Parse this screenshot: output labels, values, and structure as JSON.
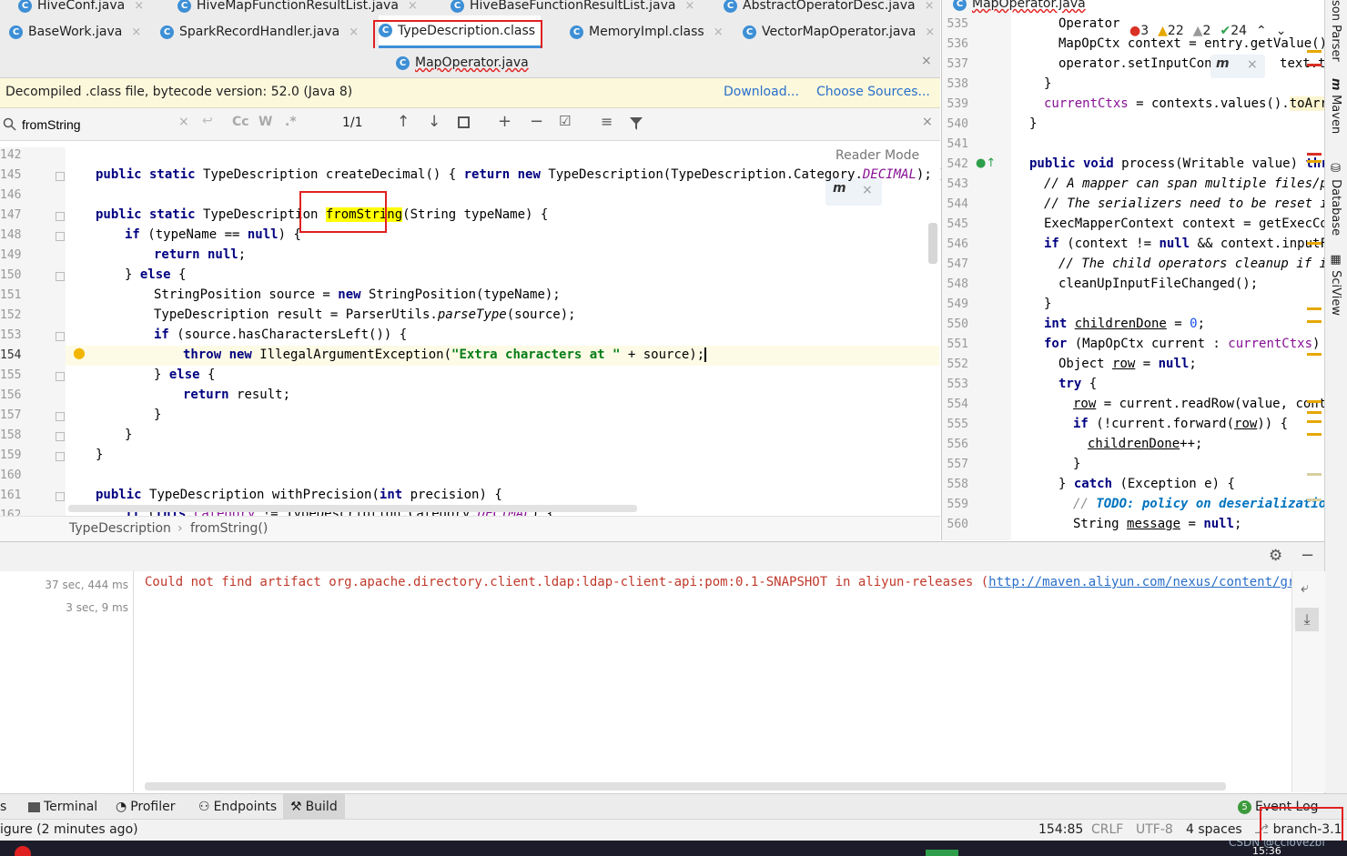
{
  "top_tabs_partial": [
    "HiveConf.java",
    "HiveMapFunctionResultList.java",
    "HiveBaseFunctionResultList.java",
    "AbstractOperatorDesc.java",
    "MapOperator.java"
  ],
  "tabs_row1": [
    "BaseWork.java",
    "SparkRecordHandler.java",
    "TypeDescription.class",
    "MemoryImpl.class",
    "VectorMapOperator.java"
  ],
  "tabs_row2": [
    "MapOperator.java"
  ],
  "banner": {
    "text": "Decompiled .class file, bytecode version: 52.0 (Java 8)",
    "download": "Download...",
    "choose_sources": "Choose Sources..."
  },
  "search": {
    "value": "fromString",
    "count": "1/1"
  },
  "reader_mode": "Reader Mode",
  "left_lines": [
    "142",
    "145",
    "146",
    "147",
    "148",
    "149",
    "150",
    "151",
    "152",
    "153",
    "154",
    "155",
    "156",
    "157",
    "158",
    "159",
    "160",
    "161",
    "162"
  ],
  "code": {
    "l145_a": "public static ",
    "l145_b": "TypeDescription createDecimal() { ",
    "l145_c": "return new ",
    "l145_d": "TypeDescription(TypeDescription.Category.",
    "l145_e": "DECIMAL",
    "l145_f": "); }",
    "l147_a": "public static ",
    "l147_b": "TypeDescription ",
    "l147_hl": "fromString",
    "l147_c": "(String typeName) {",
    "l148_a": "if ",
    "l148_b": "(typeName == ",
    "l148_c": "null",
    "l148_d": ") {",
    "l149_a": "return null",
    "l149_b": ";",
    "l150_a": "} ",
    "l150_b": "else ",
    "l150_c": "{",
    "l151_a": "StringPosition source = ",
    "l151_b": "new ",
    "l151_c": "StringPosition(typeName);",
    "l152_a": "TypeDescription result = ParserUtils.",
    "l152_b": "parseType",
    "l152_c": "(source);",
    "l153_a": "if ",
    "l153_b": "(source.hasCharactersLeft()) {",
    "l154_a": "throw new ",
    "l154_b": "IllegalArgumentException(",
    "l154_c": "\"Extra characters at \"",
    "l154_d": " + source);",
    "l155_a": "} ",
    "l155_b": "else ",
    "l155_c": "{",
    "l156_a": "return ",
    "l156_b": "result;",
    "l157": "}",
    "l158": "}",
    "l159": "}",
    "l161_a": "public ",
    "l161_b": "TypeDescription withPrecision(",
    "l161_c": "int ",
    "l161_d": "precision) {",
    "l162_a": "if ",
    "l162_b": "(",
    "l162_c": "this",
    "l162_d": ".",
    "l162_e": "category",
    "l162_f": " != TypeDescription.Category.",
    "l162_g": "DECIMAL",
    "l162_h": ") {"
  },
  "breadcrumb": {
    "class": "TypeDescription",
    "method": "fromString()"
  },
  "inspections": {
    "errors": "3",
    "warnings": "22",
    "weak": "2",
    "ok": "24"
  },
  "right_lines": [
    "535",
    "536",
    "537",
    "538",
    "539",
    "540",
    "541",
    "542",
    "543",
    "544",
    "545",
    "546",
    "547",
    "548",
    "549",
    "550",
    "551",
    "552",
    "553",
    "554",
    "555",
    "556",
    "557",
    "558",
    "559",
    "560"
  ],
  "right_code": {
    "r535": "Operator",
    "r536": "MapOpCtx context = entry.getValue();",
    "r537_a": "operator.setInputCont",
    "r537_b": "text.tab",
    "r538": "}",
    "r539_a": "currentCtxs",
    "r539_b": " = contexts.values().",
    "r539_c": "toArray",
    "r540": "}",
    "r542_a": "public void ",
    "r542_b": "process(Writable value) ",
    "r542_c": "thro",
    "r543": "// A mapper can span multiple files/par",
    "r544": "// The serializers need to be reset if",
    "r545": "ExecMapperContext context = getExecCon",
    "r546_a": "if ",
    "r546_b": "(context != ",
    "r546_c": "null ",
    "r546_d": "&& context.inputFil",
    "r547": "// The child operators cleanup if inp",
    "r548": "cleanUpInputFileChanged();",
    "r549": "}",
    "r550_a": "int ",
    "r550_b": "childrenDone",
    "r550_c": " = ",
    "r550_d": "0",
    "r550_e": ";",
    "r551_a": "for ",
    "r551_b": "(MapOpCtx current : ",
    "r551_c": "currentCtxs",
    "r551_d": ") {",
    "r552_a": "Object ",
    "r552_b": "row",
    "r552_c": " = ",
    "r552_d": "null",
    "r552_e": ";",
    "r553_a": "try ",
    "r553_b": "{",
    "r554_a": "row",
    "r554_b": " = current.readRow(value, conte",
    "r555_a": "if ",
    "r555_b": "(!current.forward(",
    "r555_c": "row",
    "r555_d": ")) {",
    "r556_a": "childrenDone",
    "r556_b": "++;",
    "r557": "}",
    "r558_a": "} ",
    "r558_b": "catch ",
    "r558_c": "(Exception e) {",
    "r559_a": "// ",
    "r559_b": "TODO: policy on deserialization",
    "r560_a": "String ",
    "r560_b": "message",
    "r560_c": " = ",
    "r560_d": "null",
    "r560_e": ";"
  },
  "side_tools": [
    "son Parser",
    "Maven",
    "Database",
    "SciView"
  ],
  "build": {
    "times": [
      "37 sec, 444 ms",
      "3 sec, 9 ms"
    ],
    "error_text": "Could not find artifact org.apache.directory.client.ldap:ldap-client-api:pom:0.1-SNAPSHOT in aliyun-releases (",
    "error_link": "http://maven.aliyun.com/nexus/content/groups/pub"
  },
  "bottom_tools": [
    "s",
    "Terminal",
    "Profiler",
    "Endpoints",
    "Build"
  ],
  "event_log": {
    "count": "5",
    "label": "Event Log"
  },
  "status": {
    "left": "igure (2 minutes ago)",
    "position": "154:85",
    "line_sep": "CRLF",
    "encoding": "UTF-8",
    "indent": "4 spaces",
    "branch": "branch-3.1"
  },
  "watermark": "CSDN @cclovezbf",
  "clock": "15:36"
}
